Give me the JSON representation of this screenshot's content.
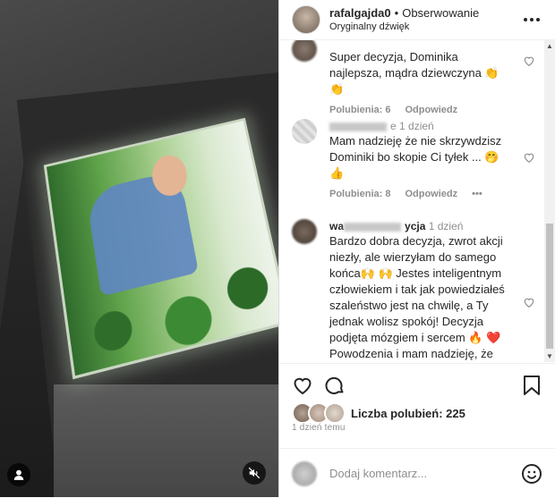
{
  "header": {
    "username": "rafalgajda0",
    "separator": "•",
    "follow_label": "Obserwowanie",
    "audio_label": "Oryginalny dźwięk"
  },
  "comments": [
    {
      "text": "Super decyzja, Dominika najlepsza, mądra dziewczyna 👏 👏",
      "likes": "Polubienia: 6",
      "reply": "Odpowiedz"
    },
    {
      "user_fragment": "e",
      "time": "1 dzień",
      "text": "Mam nadzieję że nie skrzywdzisz Dominiki bo skopie Ci tyłek ... 🤭 👍",
      "likes": "Polubienia: 8",
      "reply": "Odpowiedz",
      "more": "•••"
    },
    {
      "user_fragment": "wa",
      "user_fragment2": "ycja",
      "time": "1 dzień",
      "text": "Bardzo dobra decyzja, zwrot akcji niezły, ale wierzyłam do samego końca🙌 🙌  Jestes inteligentnym człowiekiem i tak jak powiedziałeś szaleństwo jest na chwilę, a Ty jednak wolisz spokój! Decyzja podjęta mózgiem i sercem 🔥 ❤️ Powodzenia i mam nadzieję, że jesteście dalej razem💝"
    }
  ],
  "likes_text": "Liczba polubień: 225",
  "date_text": "1 dzień temu",
  "comment_placeholder": "Dodaj komentarz...",
  "colors": {
    "text": "#262626",
    "muted": "#8e8e8e",
    "border": "#dbdbdb"
  }
}
